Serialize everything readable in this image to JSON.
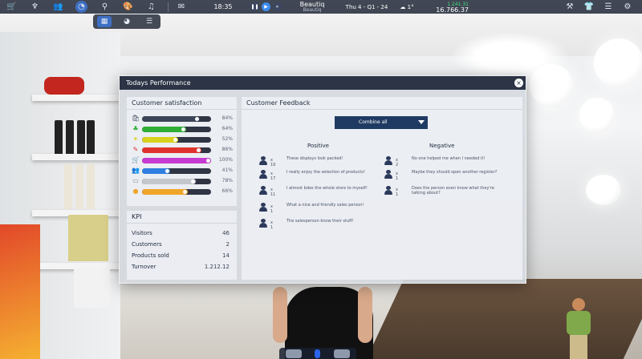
{
  "topbar": {
    "left_icons": [
      "cart-icon",
      "bonsai-icon",
      "people-icon",
      "stats-icon",
      "search-icon",
      "palette-icon",
      "music-icon"
    ],
    "time": "18:35",
    "store_name": "Beautiq",
    "store_subtitle": "Beautiq",
    "date": "Thu 4 - Q1 - 24",
    "weather": "1°",
    "income": "1.241.31",
    "balance": "16.766.37",
    "right_icons": [
      "hammer-icon",
      "shirt-icon",
      "sliders-icon",
      "gear-icon"
    ]
  },
  "subtabs": [
    "grid-tab",
    "pie-tab",
    "list-tab"
  ],
  "window": {
    "title": "Todays Performance",
    "close": "×"
  },
  "satisfaction": {
    "title": "Customer satisfaction",
    "rows": [
      {
        "icon": "bag-icon",
        "glyph": "🛍",
        "color": "#3c4458",
        "fraction": 0.84,
        "pct": "84%"
      },
      {
        "icon": "leaf-icon",
        "glyph": "♣",
        "color": "#2fae35",
        "fraction": 0.64,
        "pct": "64%"
      },
      {
        "icon": "sun-icon",
        "glyph": "✦",
        "color": "#d9d21c",
        "fraction": 0.52,
        "pct": "52%"
      },
      {
        "icon": "tag-icon",
        "glyph": "✎",
        "color": "#e0322d",
        "fraction": 0.86,
        "pct": "86%"
      },
      {
        "icon": "cart-icon",
        "glyph": "🛒",
        "color": "#c63bd1",
        "fraction": 1.0,
        "pct": "100%"
      },
      {
        "icon": "people-icon",
        "glyph": "👥",
        "color": "#2f7fe0",
        "fraction": 0.41,
        "pct": "41%"
      },
      {
        "icon": "card-icon",
        "glyph": "▭",
        "color": "#c4c7cc",
        "fraction": 0.78,
        "pct": "78%"
      },
      {
        "icon": "coin-icon",
        "glyph": "●",
        "color": "#f0a52a",
        "fraction": 0.66,
        "pct": "66%"
      }
    ]
  },
  "kpi": {
    "title": "KPI",
    "rows": [
      {
        "label": "Visitors",
        "value": "46"
      },
      {
        "label": "Customers",
        "value": "2"
      },
      {
        "label": "Products sold",
        "value": "14"
      },
      {
        "label": "Turnover",
        "value": "1.212.12"
      }
    ]
  },
  "feedback": {
    "title": "Customer Feedback",
    "dropdown": "Combine all",
    "positive_title": "Positive",
    "negative_title": "Negative",
    "positive": [
      {
        "count": "x 19",
        "text": "These displays look packed!"
      },
      {
        "count": "x 17",
        "text": "I really enjoy the selection of products!"
      },
      {
        "count": "x 11",
        "text": "I almost bdes the whole store to myself!"
      },
      {
        "count": "x 1",
        "text": "What a nice and friendly sales person!"
      },
      {
        "count": "x 1",
        "text": "The salesperson know their stuff!"
      }
    ],
    "negative": [
      {
        "count": "x 2",
        "text": "No one helped me when I needed it!"
      },
      {
        "count": "x 1",
        "text": "Maybe they should open another register?"
      },
      {
        "count": "x 1",
        "text": "Does the person even know what they're talking about?"
      }
    ]
  }
}
